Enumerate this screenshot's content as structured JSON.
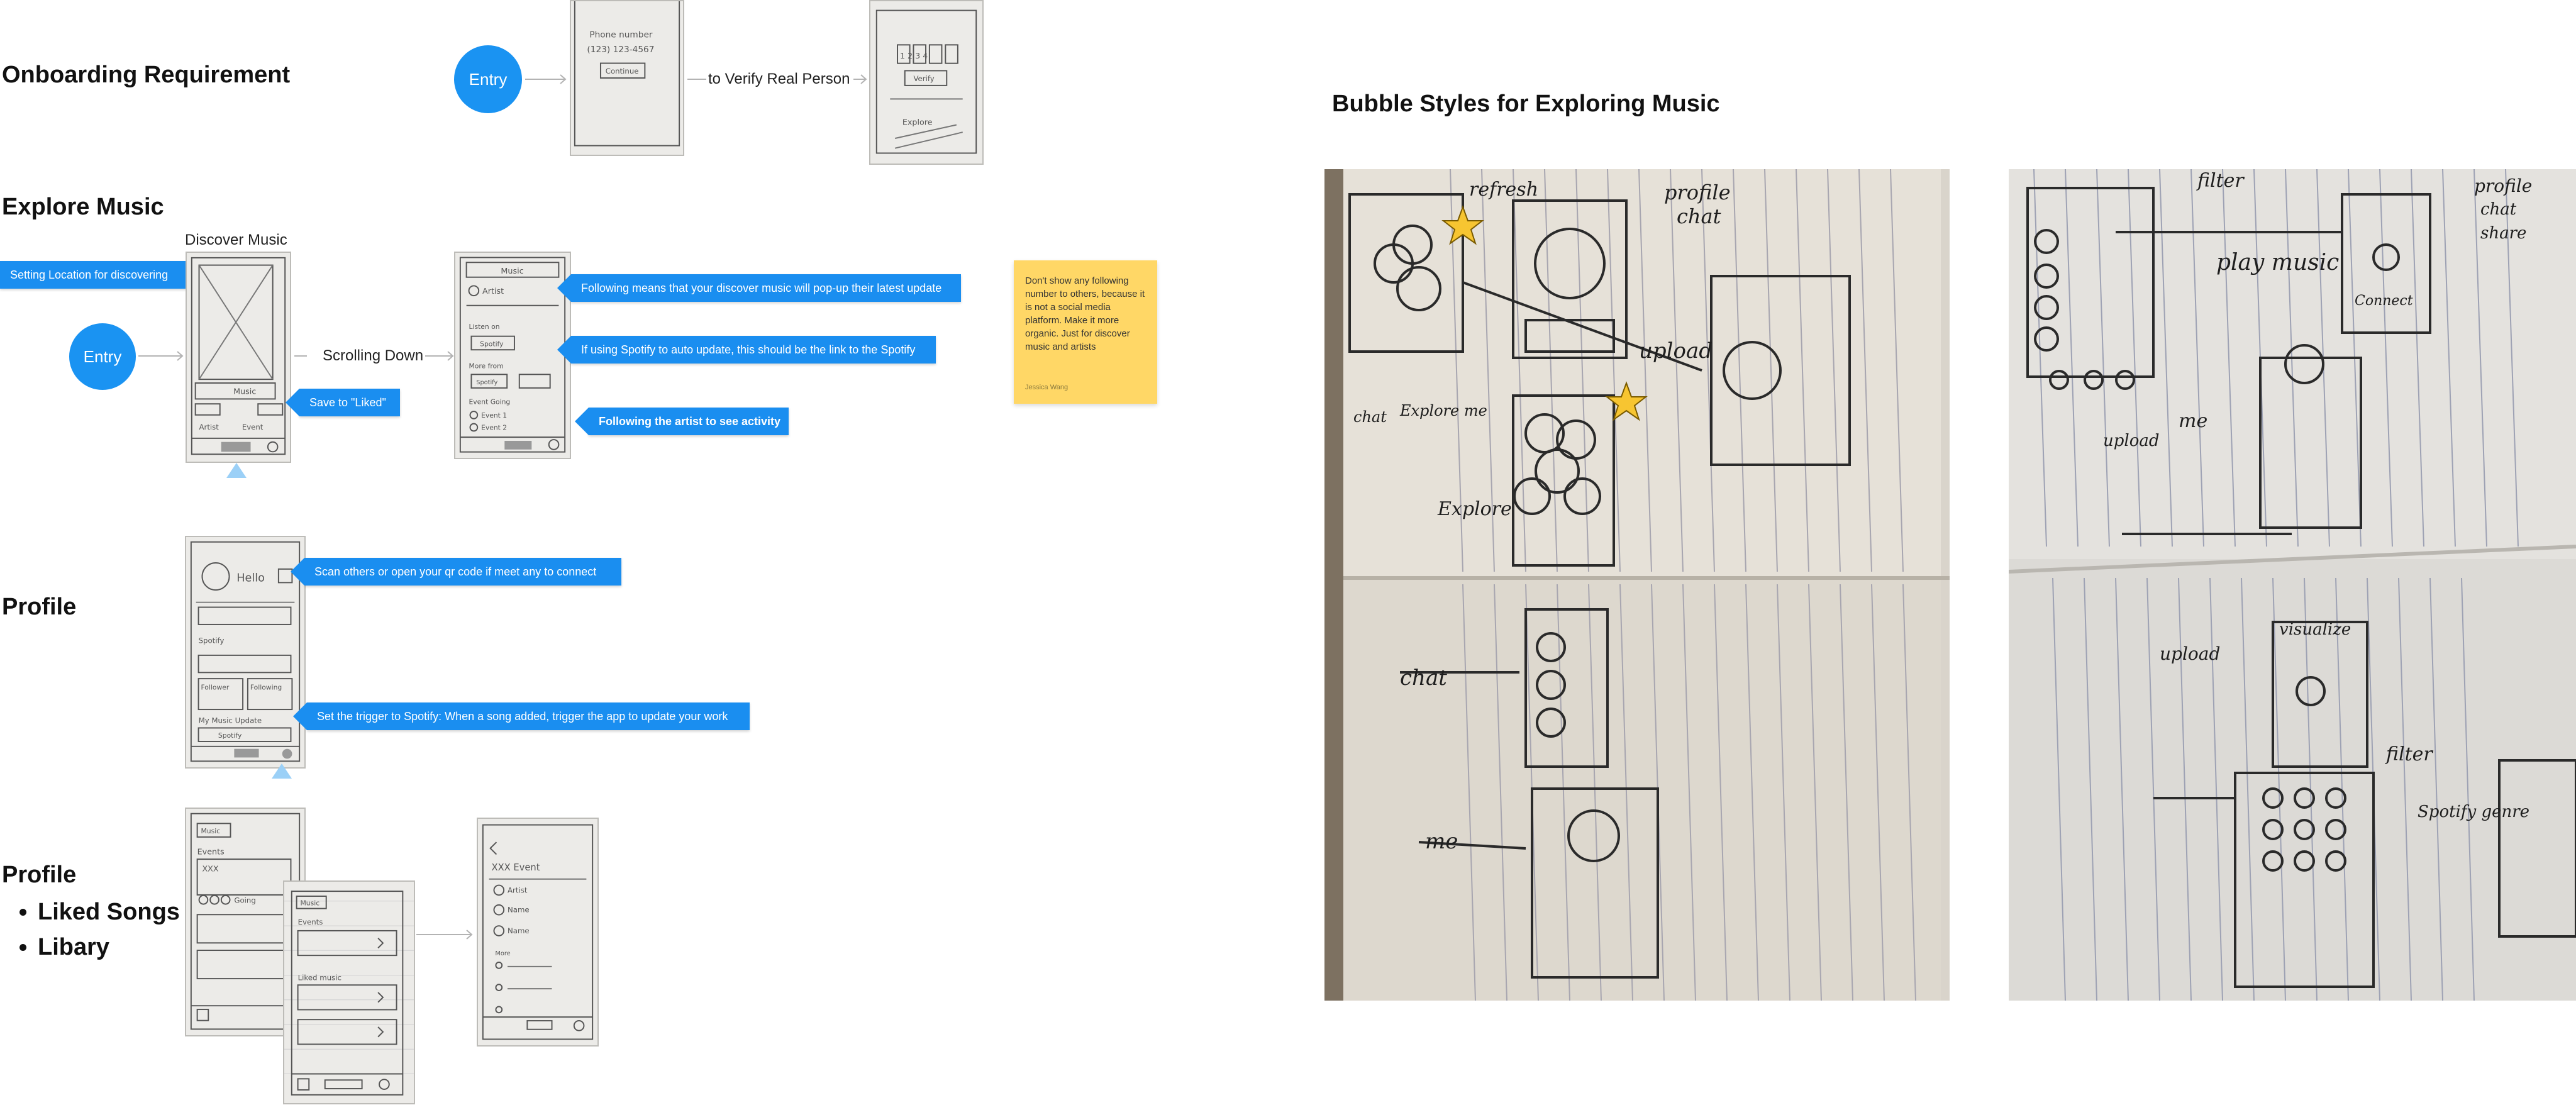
{
  "sections": {
    "onboarding_title": "Onboarding Requirement",
    "explore_title": "Explore Music",
    "profile_title": "Profile",
    "profile2_title": "Profile",
    "bubble_title": "Bubble Styles for Exploring Music"
  },
  "onboarding": {
    "entry_label": "Entry",
    "verify_label": "to Verify Real Person",
    "phone_sketch_text": [
      "Phone number",
      "(123) 123-4567",
      "Continue"
    ],
    "code_sketch_text": [
      "1 2 3 4",
      "Verify",
      "Explore"
    ]
  },
  "explore": {
    "discover_label": "Discover Music",
    "entry_label": "Entry",
    "scrolling_label": "Scrolling Down",
    "callouts": {
      "location": "Setting Location for discovering",
      "liked": "Save to \"Liked\"",
      "following": "Following means that your discover music will pop-up their latest update",
      "spotify": "If using Spotify to auto update, this should be the link to the Spotify",
      "artist": "Following the artist to see activity"
    },
    "discover_sketch_text": [
      "Music",
      "Artist",
      "Event"
    ],
    "scroll_sketch_text": [
      "Music",
      "Artist",
      "Listen on",
      "Spotify",
      "More from",
      "Spotify",
      "Event Going",
      "Event 1",
      "Event 2"
    ]
  },
  "sticky_note": {
    "body": "Don't show any following number to others, because it is not a social media platform. Make it more organic. Just for discover music and artists",
    "author": "Jessica Wang"
  },
  "profile": {
    "callout_scan": "Scan others or open your qr code if meet any to connect",
    "callout_trigger": "Set the trigger to Spotify: When a song added, trigger the app to update your work",
    "sketch_text": [
      "Hello",
      "Spotify",
      "Follower",
      "Following",
      "My Music Update",
      "Spotify"
    ]
  },
  "profile2": {
    "items": [
      "Liked Songs",
      "Libary"
    ],
    "sketch_text": [
      "Music",
      "Events",
      "XXX",
      "Going",
      "Liked music",
      "XXX Event",
      "Artist",
      "Name",
      "Name",
      "More"
    ]
  },
  "bubble": {
    "left_notes": [
      "refresh",
      "profile",
      "chat",
      "upload",
      "chat",
      "Explore me",
      "Explore",
      "chat",
      "me"
    ],
    "right_notes": [
      "filter",
      "profile",
      "chat",
      "share",
      "play music",
      "Connect",
      "upload",
      "me",
      "visualize",
      "filter",
      "Spotify genre"
    ]
  },
  "colors": {
    "accent_blue": "#1a93f2",
    "callout_blue": "#1a8ef0",
    "sticky_yellow": "#ffd766",
    "marker_blue": "#9bd0f7",
    "star_yellow": "#f7c531"
  }
}
